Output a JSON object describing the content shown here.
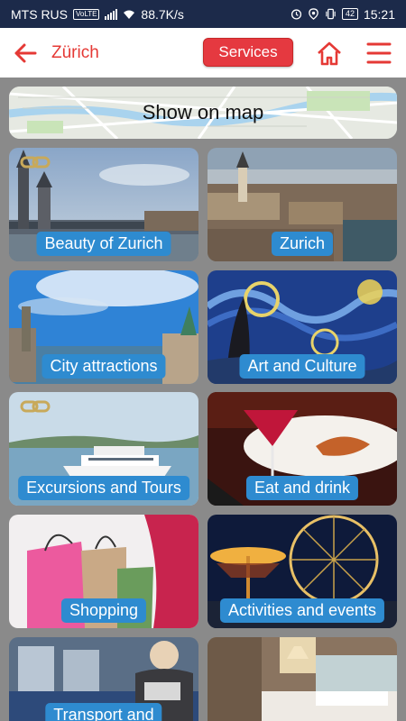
{
  "status_bar": {
    "carrier": "MTS RUS",
    "volte": "VoLTE",
    "speed": "88.7K/s",
    "battery": "42",
    "time": "15:21"
  },
  "header": {
    "title": "Zürich",
    "services_label": "Services"
  },
  "map": {
    "label": "Show on map"
  },
  "tiles": [
    {
      "label": "Beauty of Zurich"
    },
    {
      "label": "Zurich"
    },
    {
      "label": "City attractions"
    },
    {
      "label": "Art and Culture"
    },
    {
      "label": "Excursions and Tours"
    },
    {
      "label": "Eat and drink"
    },
    {
      "label": "Shopping"
    },
    {
      "label": "Activities and events"
    },
    {
      "label": "Transport and"
    }
  ],
  "colors": {
    "accent": "#e53935",
    "label_bg": "#2e8bd0",
    "status_bar": "#1c2a4a"
  }
}
